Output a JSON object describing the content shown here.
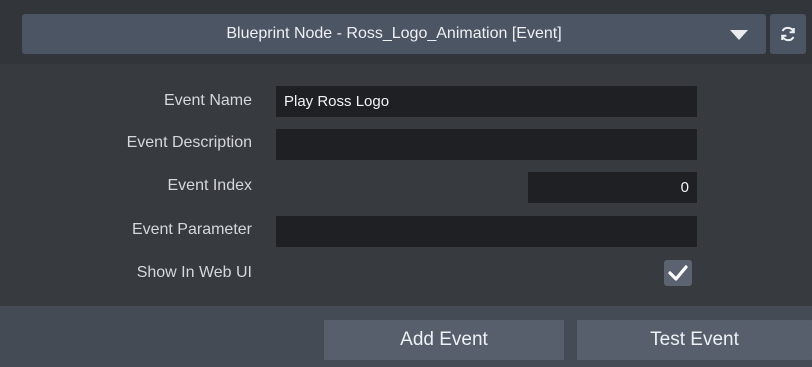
{
  "header": {
    "node_title": "Blueprint Node - Ross_Logo_Animation [Event]",
    "dropdown_icon": "chevron-down-icon",
    "refresh_icon": "refresh-icon"
  },
  "form": {
    "event_name": {
      "label": "Event Name",
      "value": "Play Ross Logo"
    },
    "event_description": {
      "label": "Event Description",
      "value": ""
    },
    "event_index": {
      "label": "Event Index",
      "value": "0"
    },
    "event_parameter": {
      "label": "Event Parameter",
      "value": ""
    },
    "show_in_web_ui": {
      "label": "Show In Web UI",
      "checked": true
    }
  },
  "footer": {
    "add_event": "Add Event",
    "test_event": "Test Event"
  },
  "colors": {
    "background": "#373a3f",
    "input_bg": "#1e2023",
    "button_bg": "#575f6c",
    "dropdown_bg": "#4c5563"
  }
}
